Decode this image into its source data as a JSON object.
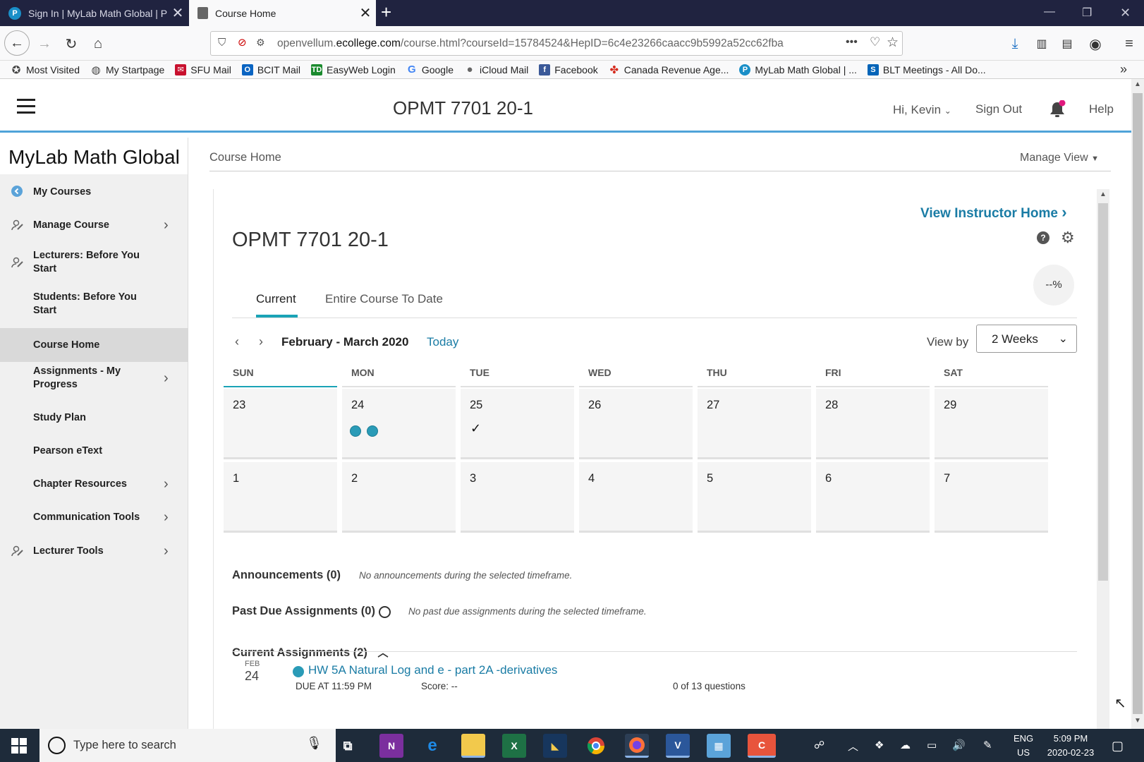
{
  "browser": {
    "tabs": [
      {
        "title": "Sign In | MyLab Math Global | P",
        "active": false
      },
      {
        "title": "Course Home",
        "active": true
      }
    ],
    "url_prefix": "openvellum.",
    "url_domain": "ecollege.com",
    "url_path": "/course.html?courseId=15784524&HepID=6c4e23266caacc9b5992a52cc62fba",
    "bookmarks": [
      {
        "label": "Most Visited",
        "icon": "star-gear-icon"
      },
      {
        "label": "My Startpage",
        "icon": "globe-icon"
      },
      {
        "label": "SFU Mail",
        "icon": "envelope-icon"
      },
      {
        "label": "BCIT Mail",
        "icon": "outlook-icon"
      },
      {
        "label": "EasyWeb Login",
        "icon": "td-icon"
      },
      {
        "label": "Google",
        "icon": "google-icon"
      },
      {
        "label": "iCloud Mail",
        "icon": "apple-icon"
      },
      {
        "label": "Facebook",
        "icon": "facebook-icon"
      },
      {
        "label": "Canada Revenue Age...",
        "icon": "maple-leaf-icon"
      },
      {
        "label": "MyLab Math Global | ...",
        "icon": "pearson-icon"
      },
      {
        "label": "BLT Meetings - All Do...",
        "icon": "sharepoint-icon"
      }
    ]
  },
  "header": {
    "course_title": "OPMT 7701 20-1",
    "greeting": "Hi, Kevin",
    "sign_out": "Sign Out",
    "help": "Help"
  },
  "sidebar": {
    "brand": "MyLab Math Global",
    "items": [
      {
        "label": "My Courses",
        "icon": "back-arrow-circle-icon",
        "chevron": false,
        "active": false
      },
      {
        "label": "Manage Course",
        "icon": "pencil-person-icon",
        "chevron": true,
        "active": false
      },
      {
        "label": "Lecturers: Before You Start",
        "icon": "pencil-person-icon",
        "chevron": false,
        "active": false
      },
      {
        "label": "Students: Before You Start",
        "icon": "",
        "chevron": false,
        "active": false
      },
      {
        "label": "Course Home",
        "icon": "",
        "chevron": false,
        "active": true
      },
      {
        "label": "Assignments - My Progress",
        "icon": "",
        "chevron": true,
        "active": false
      },
      {
        "label": "Study Plan",
        "icon": "",
        "chevron": false,
        "active": false
      },
      {
        "label": "Pearson eText",
        "icon": "",
        "chevron": false,
        "active": false
      },
      {
        "label": "Chapter Resources",
        "icon": "",
        "chevron": true,
        "active": false
      },
      {
        "label": "Communication Tools",
        "icon": "",
        "chevron": true,
        "active": false
      },
      {
        "label": "Lecturer Tools",
        "icon": "pencil-person-icon",
        "chevron": true,
        "active": false
      }
    ]
  },
  "main": {
    "breadcrumb": "Course Home",
    "manage_view": "Manage View",
    "view_instructor_home": "View Instructor Home",
    "title": "OPMT 7701 20-1",
    "percent": "--%",
    "tabs": [
      {
        "label": "Current",
        "active": true
      },
      {
        "label": "Entire Course To Date",
        "active": false
      }
    ],
    "date_range": "February - March 2020",
    "today": "Today",
    "view_by_label": "View by",
    "view_by_value": "2 Weeks",
    "days_of_week": [
      "SUN",
      "MON",
      "TUE",
      "WED",
      "THU",
      "FRI",
      "SAT"
    ],
    "weeks": [
      [
        {
          "day": "23",
          "dots": 0,
          "check": false
        },
        {
          "day": "24",
          "dots": 2,
          "check": false
        },
        {
          "day": "25",
          "dots": 0,
          "check": true
        },
        {
          "day": "26",
          "dots": 0,
          "check": false
        },
        {
          "day": "27",
          "dots": 0,
          "check": false
        },
        {
          "day": "28",
          "dots": 0,
          "check": false
        },
        {
          "day": "29",
          "dots": 0,
          "check": false
        }
      ],
      [
        {
          "day": "1",
          "dots": 0,
          "check": false
        },
        {
          "day": "2",
          "dots": 0,
          "check": false
        },
        {
          "day": "3",
          "dots": 0,
          "check": false
        },
        {
          "day": "4",
          "dots": 0,
          "check": false
        },
        {
          "day": "5",
          "dots": 0,
          "check": false
        },
        {
          "day": "6",
          "dots": 0,
          "check": false
        },
        {
          "day": "7",
          "dots": 0,
          "check": false
        }
      ]
    ],
    "announcements": {
      "title": "Announcements (0)",
      "note": "No announcements during the selected timeframe."
    },
    "past_due": {
      "title": "Past Due Assignments (0)",
      "note": "No past due assignments during the selected timeframe."
    },
    "current_assignments": {
      "title": "Current Assignments (2)",
      "items": [
        {
          "month": "FEB",
          "day": "24",
          "title": "HW 5A Natural Log and e - part 2A -derivatives",
          "due": "DUE AT 11:59 PM",
          "score": "Score: --",
          "questions": "0 of 13 questions"
        }
      ]
    }
  },
  "taskbar": {
    "search_placeholder": "Type here to search",
    "lang_line1": "ENG",
    "lang_line2": "US",
    "time": "5:09 PM",
    "date": "2020-02-23"
  },
  "colors": {
    "accent": "#1a7ca5",
    "teal": "#1aa3b6",
    "dot": "#2a9bb7",
    "header_rule": "#4fa3d9"
  }
}
